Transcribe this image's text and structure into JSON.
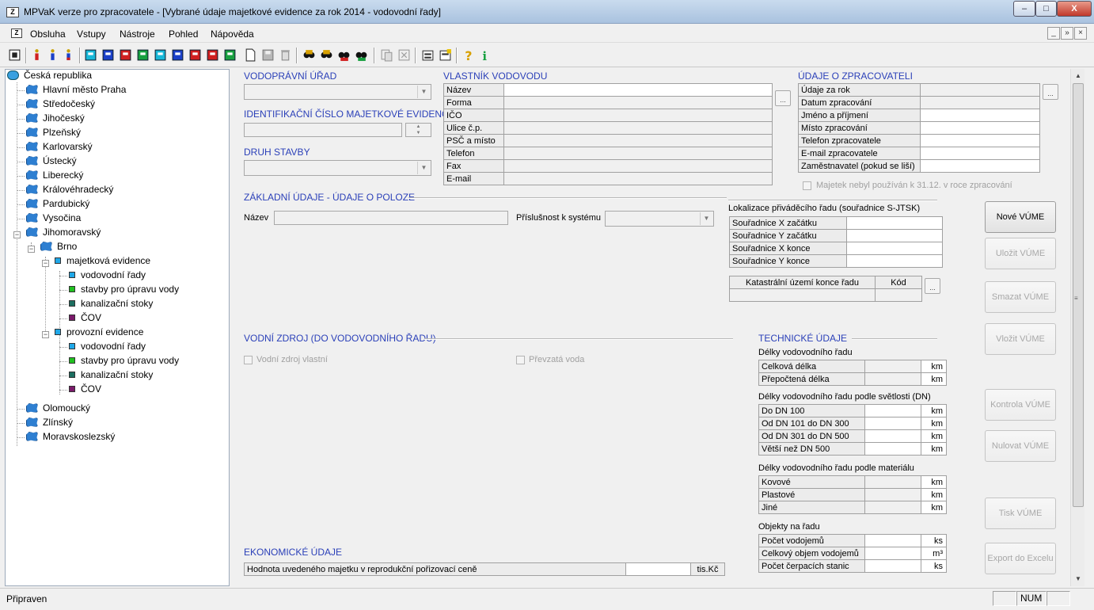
{
  "window": {
    "title": "MPVaK verze pro zpracovatele - [Vybrané údaje majetkové evidence za rok 2014 - vodovodní řady]",
    "app_icon": "Z",
    "controls": {
      "minimize": "–",
      "maximize": "□",
      "close": "X"
    }
  },
  "menu": {
    "items": [
      "Obsluha",
      "Vstupy",
      "Nástroje",
      "Pohled",
      "Nápověda"
    ],
    "mdi": {
      "minimize": "_",
      "restore": "»",
      "close": "×"
    }
  },
  "toolbar": {
    "icons": [
      "view-icon",
      "person-red-icon",
      "person-blue-icon",
      "person-green-icon",
      "db-cyan-icon",
      "db-blue-icon",
      "db-red-icon",
      "db-green-icon",
      "db-cyan2-icon",
      "db-darkblue-icon",
      "db-darkred-icon",
      "db-darkgreen-icon",
      "new-document-icon",
      "save-icon",
      "delete-icon",
      "find-icon",
      "find-next-icon",
      "find-red-icon",
      "find-green-icon",
      "copy-icon",
      "close-doc-icon",
      "properties-icon",
      "properties2-icon",
      "help-icon",
      "info-icon"
    ],
    "colors": {
      "red": "#d02020",
      "blue": "#1a40c8",
      "cyan": "#18b8d8",
      "green": "#18a040",
      "dark": "#202020",
      "yellow": "#e8c000"
    }
  },
  "tree": {
    "root": "Česká republika",
    "regions": [
      "Hlavní město Praha",
      "Středočeský",
      "Jihočeský",
      "Plzeňský",
      "Karlovarský",
      "Ústecký",
      "Liberecký",
      "Královéhradecký",
      "Pardubický",
      "Vysočina",
      "Jihomoravský"
    ],
    "city": "Brno",
    "majetkova": {
      "label": "majetková evidence",
      "children": [
        "vodovodní řady",
        "stavby pro úpravu vody",
        "kanalizační stoky",
        "ČOV"
      ]
    },
    "provozni": {
      "label": "provozní evidence",
      "children": [
        "vodovodní řady",
        "stavby pro úpravu vody",
        "kanalizační stoky",
        "ČOV"
      ]
    },
    "regions_after": [
      "Olomoucký",
      "Zlínský",
      "Moravskoslezský"
    ],
    "child_colors": [
      "#20a8e8",
      "#20c020",
      "#1c6e60",
      "#7a1a6a"
    ],
    "expander_open": "−"
  },
  "form": {
    "vodopravni_urad": {
      "label": "VODOPRÁVNÍ ÚŘAD",
      "value": ""
    },
    "ident_cislo": {
      "label": "IDENTIFIKAČNÍ ČÍSLO MAJETKOVÉ EVIDENCE",
      "value": ""
    },
    "druh_stavby": {
      "label": "DRUH STAVBY",
      "value": ""
    },
    "vlastnik": {
      "label": "VLASTNÍK VODOVODU",
      "rows": [
        "Název",
        "Forma",
        "IČO",
        "Ulice č.p.",
        "PSČ a místo",
        "Telefon",
        "Fax",
        "E-mail"
      ]
    },
    "zpracovatel": {
      "label": "ÚDAJE O ZPRACOVATELI",
      "rows": [
        "Údaje za rok",
        "Datum zpracování",
        "Jméno a příjmení",
        "Místo zpracování",
        "Telefon zpracovatele",
        "E-mail zpracovatele",
        "Zaměstnavatel (pokud se liší)"
      ]
    },
    "majetek_checkbox": "Majetek nebyl používán k 31.12. v roce zpracování",
    "zakladni": {
      "label": "ZÁKLADNÍ ÚDAJE - ÚDAJE O POLOZE",
      "nazev": "Název",
      "prislusnost": "Příslušnost k systému"
    },
    "lokalizace": {
      "label": "Lokalizace přiváděcího řadu (souřadnice S-JTSK)",
      "rows": [
        "Souřadnice X začátku",
        "Souřadnice Y začátku",
        "Souřadnice X konce",
        "Souřadnice Y konce"
      ]
    },
    "katastr": {
      "col1": "Katastrální území konce řadu",
      "col2": "Kód"
    },
    "vodni_zdroj": {
      "label": "VODNÍ ZDROJ (DO VODOVODNÍHO ŘADU)",
      "vlastni": "Vodní zdroj vlastní",
      "prevzata": "Převzatá voda"
    },
    "technicke": {
      "label": "TECHNICKÉ ÚDAJE",
      "delky_label": "Délky vodovodního řadu",
      "delky": [
        [
          "Celková délka",
          "km"
        ],
        [
          "Přepočtená délka",
          "km"
        ]
      ],
      "dn_label": "Délky vodovodního řadu podle světlosti (DN)",
      "dn": [
        [
          "Do DN 100",
          "km"
        ],
        [
          "Od DN 101 do DN 300",
          "km"
        ],
        [
          "Od DN 301 do DN 500",
          "km"
        ],
        [
          "Větší než  DN 500",
          "km"
        ]
      ],
      "mat_label": "Délky vodovodního řadu podle materiálu",
      "mat": [
        [
          "Kovové",
          "km"
        ],
        [
          "Plastové",
          "km"
        ],
        [
          "Jiné",
          "km"
        ]
      ],
      "obj_label": "Objekty na řadu",
      "obj": [
        [
          "Počet vodojemů",
          "ks"
        ],
        [
          "Celkový objem vodojemů",
          "m³"
        ],
        [
          "Počet čerpacích stanic",
          "ks"
        ]
      ]
    },
    "ekonomicke": {
      "label": "EKONOMICKÉ ÚDAJE",
      "row": "Hodnota uvedeného majetku v reprodukční pořizovací ceně",
      "unit": "tis.Kč"
    },
    "dots": "..."
  },
  "buttons": {
    "nove": "Nové VÚME",
    "ulozit": "Uložit VÚME",
    "smazat": "Smazat VÚME",
    "vlozit": "Vložit VÚME",
    "kontrola": "Kontrola VÚME",
    "nulovat": "Nulovat VÚME",
    "tisk": "Tisk VÚME",
    "export": "Export do Excelu"
  },
  "status": {
    "text": "Připraven",
    "num": "NUM"
  },
  "scroll": {
    "up": "▲",
    "down": "▼",
    "grip": "≡"
  }
}
